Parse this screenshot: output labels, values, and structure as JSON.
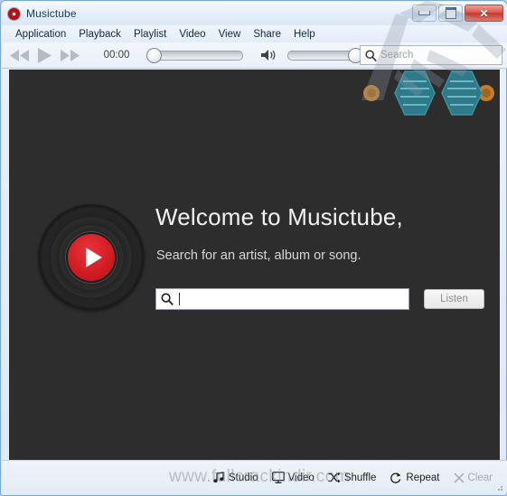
{
  "window": {
    "title": "Musictube",
    "title_icon": "record-icon",
    "controls": {
      "minimize": "minimize-button",
      "maximize": "maximize-button",
      "close_label": "✕"
    }
  },
  "menu": {
    "items": [
      {
        "label": "Application"
      },
      {
        "label": "Playback"
      },
      {
        "label": "Playlist"
      },
      {
        "label": "Video"
      },
      {
        "label": "View"
      },
      {
        "label": "Share"
      },
      {
        "label": "Help"
      }
    ]
  },
  "toolbar": {
    "rewind_icon": "rewind-icon",
    "play_icon": "play-icon",
    "forward_icon": "fast-forward-icon",
    "time": "00:00",
    "seek_value": 0,
    "volume_icon": "volume-icon",
    "volume_value": 100,
    "search": {
      "icon": "search-icon",
      "placeholder": "Search",
      "value": ""
    }
  },
  "main": {
    "logo": "vinyl-record-play-logo",
    "title": "Welcome to Musictube,",
    "subtitle": "Search for an artist, album or song.",
    "search": {
      "icon": "search-icon",
      "value": "",
      "placeholder": ""
    },
    "listen_button": "Listen"
  },
  "status_bar": {
    "items": [
      {
        "label": "Studio",
        "icon": "music-note-icon",
        "disabled": false
      },
      {
        "label": "Video",
        "icon": "monitor-icon",
        "disabled": false
      },
      {
        "label": "Shuffle",
        "icon": "shuffle-icon",
        "disabled": false
      },
      {
        "label": "Repeat",
        "icon": "repeat-icon",
        "disabled": false
      },
      {
        "label": "Clear",
        "icon": "close-x-icon",
        "disabled": true
      }
    ]
  },
  "watermark": {
    "text": "www.fullcrackindir.com"
  },
  "colors": {
    "accent_red": "#cf1b22",
    "content_bg": "#2d2d2d",
    "chrome_blue": "#dce9f7",
    "deco_teal": "#2d7f8f",
    "deco_orange": "#c9822a"
  }
}
